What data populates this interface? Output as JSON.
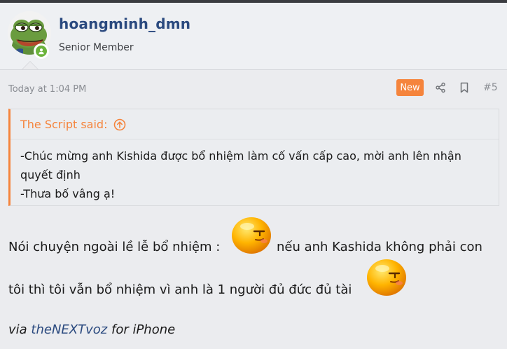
{
  "user": {
    "username": "hoangminh_dmn",
    "title": "Senior Member",
    "avatar_icon": "pepe-frog-avatar",
    "status_icon": "online-status-icon"
  },
  "post": {
    "time": "Today at 1:04 PM",
    "badge": "New",
    "share_icon": "share-icon",
    "bookmark_icon": "bookmark-icon",
    "number": "#5"
  },
  "quote": {
    "author_label": "The Script said:",
    "jump_icon": "arrow-up-circle-icon",
    "lines": [
      "-Chúc mừng anh Kishida được bổ nhiệm làm cố vấn cấp cao, mời anh lên nhận",
      "quyết định",
      "-Thưa bố vâng ạ!"
    ]
  },
  "body": {
    "line1_a": "Nói chuyện ngoài lề lễ bổ nhiệm :",
    "line1_b": "nếu anh Kashida không phải con",
    "line2": "tôi thì tôi vẫn bổ nhiệm vì anh là 1 người đủ đức đủ tài",
    "emoji_icon": "smirk-emoji-icon"
  },
  "signature": {
    "prefix": "via",
    "app": "theNEXTvoz",
    "suffix": "for iPhone"
  },
  "colors": {
    "accent": "#f5843c",
    "username": "#2b4a7f",
    "online": "#6bb33c"
  }
}
